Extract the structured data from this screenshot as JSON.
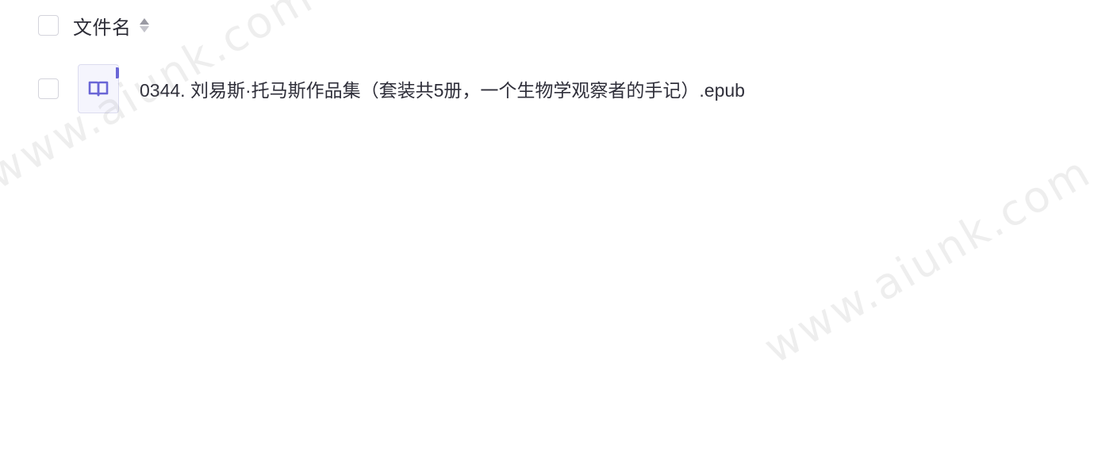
{
  "file_list": {
    "header": {
      "column_title": "文件名",
      "sort_icon": "sort-toggle-icon"
    },
    "rows": [
      {
        "icon": "ebook-icon",
        "file_name": "0344. 刘易斯·托马斯作品集（套装共5册，一个生物学观察者的手记）.epub"
      }
    ]
  },
  "watermarks": [
    "www.aiunk.com",
    "www.aiunk.com"
  ],
  "colors": {
    "icon_accent": "#6a66d6",
    "icon_background": "#f5f5fd",
    "text": "#2f2f3a",
    "checkbox_border": "#d4d4dc"
  }
}
